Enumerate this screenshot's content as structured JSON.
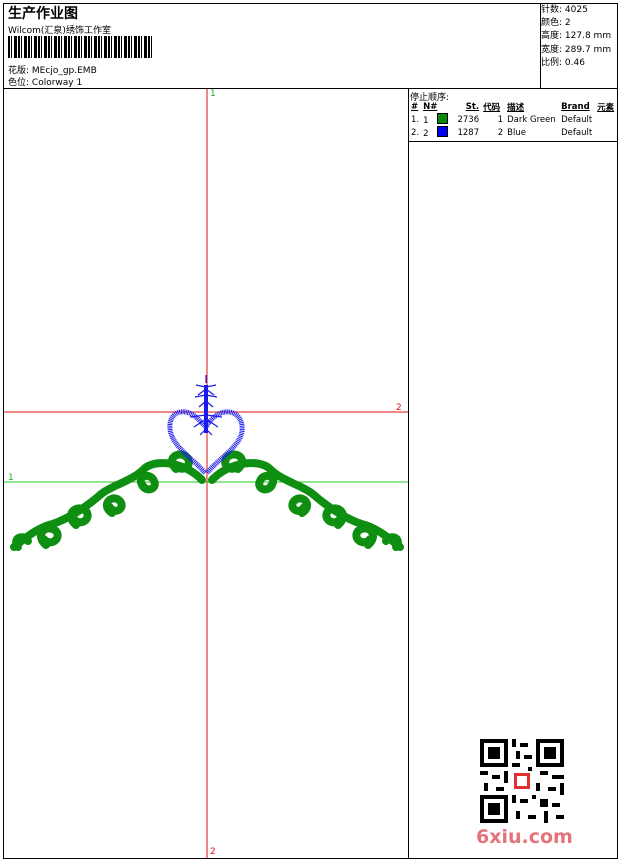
{
  "header": {
    "title": "生产作业图",
    "company": "Wilcom(汇泉)绣饰工作室",
    "design_label": "花版:",
    "design_value": "MEcjo_gp.EMB",
    "colorway_label": "色位:",
    "colorway_value": "Colorway 1"
  },
  "stats": {
    "stitches_label": "针数:",
    "stitches": "4025",
    "colors_label": "颜色:",
    "colors": "2",
    "height_label": "高度:",
    "height": "127.8 mm",
    "width_label": "宽度:",
    "width": "289.7 mm",
    "scale_label": "比例:",
    "scale": "0.46"
  },
  "stop_sequence": {
    "heading": "停止顺序:",
    "columns": [
      "#",
      "N#",
      "St.",
      "代码",
      "描述",
      "Brand",
      "元素"
    ],
    "rows": [
      {
        "num": "1.",
        "n": "1",
        "color": "#0a8a0a",
        "st": "2736",
        "code": "1",
        "desc": "Dark Green",
        "brand": "Default",
        "elem": ""
      },
      {
        "num": "2.",
        "n": "2",
        "color": "#0000ee",
        "st": "1287",
        "code": "2",
        "desc": "Blue",
        "brand": "Default",
        "elem": ""
      }
    ]
  },
  "guides": {
    "vertical_top": "1",
    "vertical_bottom": "2",
    "horizontal_red_right": "2",
    "horizontal_green_left": "1"
  },
  "watermark": "6xiu.com",
  "colors": {
    "green_thread": "#0f8f12",
    "blue_thread": "#1a1aee",
    "red_guide": "#e01010",
    "green_guide": "#22cc22"
  }
}
